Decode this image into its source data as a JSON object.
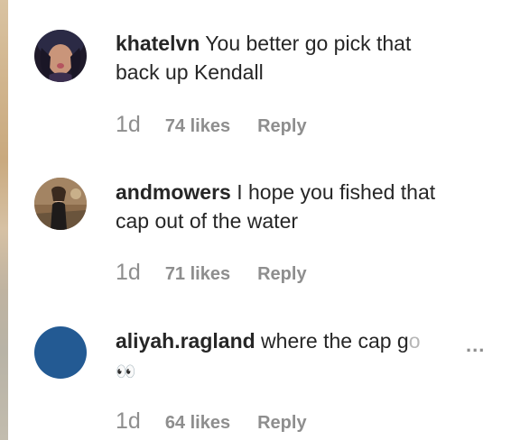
{
  "comments": [
    {
      "username": "khatelvn",
      "text_line1": " You better go pick that",
      "text_line2": "back up Kendall",
      "time": "1d",
      "likes": "74 likes",
      "reply": "Reply"
    },
    {
      "username": "andmowers",
      "text_line1": " I hope you fished that",
      "text_line2": "cap out of the water",
      "time": "1d",
      "likes": "71 likes",
      "reply": "Reply"
    },
    {
      "username": "aliyah.ragland",
      "text_line1": " where the cap g",
      "text_faded": "o",
      "more": "...",
      "text_line2": "👀",
      "time": "1d",
      "likes": "64 likes",
      "reply": "Reply",
      "avatar_color": "#235a93"
    }
  ]
}
